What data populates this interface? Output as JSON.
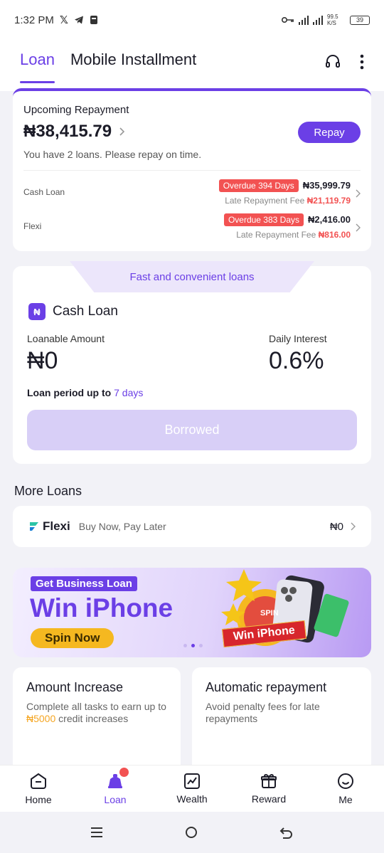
{
  "status_bar": {
    "time": "1:32 PM",
    "net_speed": "99.5 K/S",
    "battery": "39"
  },
  "header": {
    "tabs": [
      {
        "label": "Loan"
      },
      {
        "label": "Mobile Installment"
      }
    ]
  },
  "repayment": {
    "title": "Upcoming Repayment",
    "amount": "₦38,415.79",
    "button_label": "Repay",
    "note": "You have 2 loans. Please repay on time.",
    "loans": [
      {
        "name": "Cash Loan",
        "overdue": "Overdue 394 Days",
        "amount": "₦35,999.79",
        "fee_label": "Late Repayment Fee",
        "fee": "₦21,119.79"
      },
      {
        "name": "Flexi",
        "overdue": "Overdue 383 Days",
        "amount": "₦2,416.00",
        "fee_label": "Late Repayment Fee",
        "fee": "₦816.00"
      }
    ]
  },
  "cash_loan": {
    "promo": "Fast and convenient loans",
    "title": "Cash Loan",
    "loanable_label": "Loanable Amount",
    "loanable_value": "₦0",
    "interest_label": "Daily Interest",
    "interest_value": "0.6%",
    "period_text": "Loan period up to",
    "period_value": "7 days",
    "button_label": "Borrowed"
  },
  "more_loans": {
    "title": "More Loans",
    "flexi": {
      "name": "Flexi",
      "subtitle": "Buy Now, Pay Later",
      "amount": "₦0"
    }
  },
  "banner": {
    "tag": "Get Business Loan",
    "title": "Win iPhone",
    "button": "Spin Now",
    "ribbon": "Win iPhone",
    "spin": "SPIN"
  },
  "tasks": [
    {
      "title": "Amount Increase",
      "desc_pre": "Complete all tasks to earn up to",
      "highlight": "₦5000",
      "desc_post": "credit increases"
    },
    {
      "title": "Automatic repayment",
      "desc": "Avoid penalty fees for late repayments"
    }
  ],
  "nav": [
    {
      "label": "Home"
    },
    {
      "label": "Loan"
    },
    {
      "label": "Wealth"
    },
    {
      "label": "Reward"
    },
    {
      "label": "Me"
    }
  ],
  "colors": {
    "accent": "#6b3fe6",
    "danger": "#f25252",
    "highlight": "#f5a623"
  }
}
